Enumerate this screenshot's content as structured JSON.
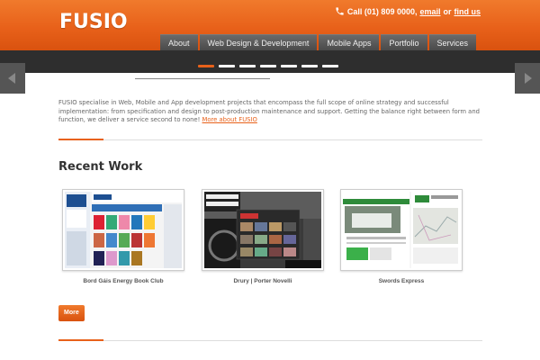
{
  "header": {
    "logo": "FUSIO",
    "contact": {
      "call_text": "Call (01) 809 0000,",
      "email_link": "email",
      "or_text": "or",
      "find_link": "find us"
    },
    "nav": [
      "About",
      "Web Design & Development",
      "Mobile Apps",
      "Portfolio",
      "Services"
    ]
  },
  "slider": {
    "dot_count": 7,
    "active_dot": 0
  },
  "intro": {
    "text": "FUSIO specialise in Web, Mobile and App development projects that encompass the full scope of online strategy and successful implementation: from specification and design to post-production maintenance and support. Getting the balance right between form and function, we deliver a service second to none!",
    "link": "More about FUSIO"
  },
  "recent_work": {
    "title": "Recent Work",
    "items": [
      {
        "caption": "Bord Gáis Energy Book Club"
      },
      {
        "caption": "Drury | Porter Novelli"
      },
      {
        "caption": "Swords Express"
      }
    ],
    "more_label": "More"
  },
  "colors": {
    "accent": "#e8611a",
    "nav_bg": "#555555",
    "band": "#2e2e2e"
  }
}
